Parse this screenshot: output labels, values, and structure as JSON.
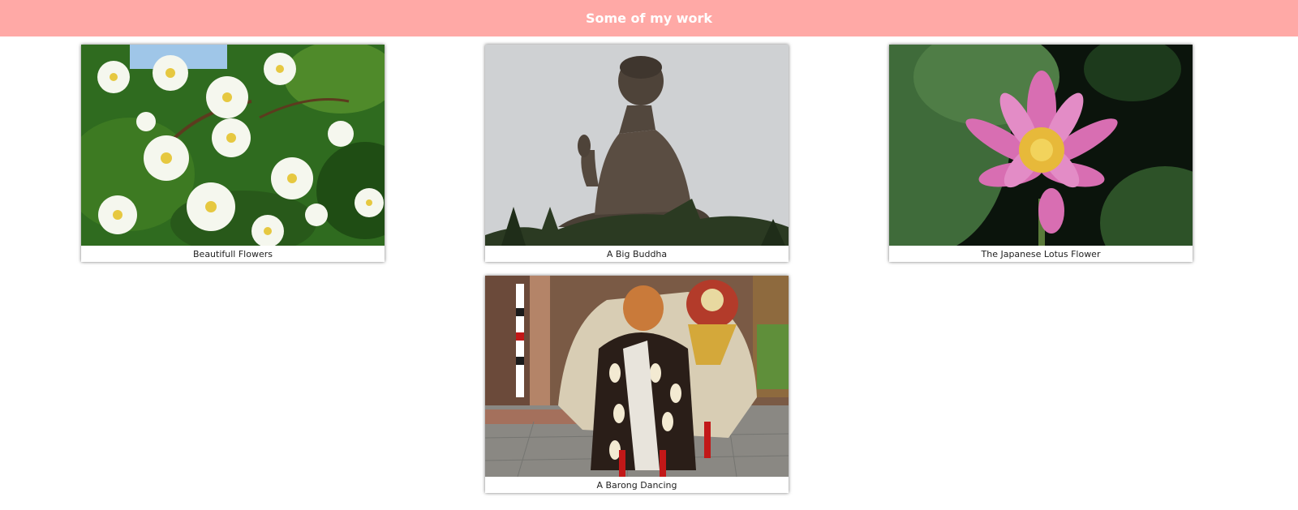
{
  "header": {
    "title": "Some of my work",
    "background": "#ffa9a6"
  },
  "gallery": [
    {
      "caption": "Beautifull Flowers",
      "image": "white-jasmine-flowers-photo"
    },
    {
      "caption": "A Big Buddha",
      "image": "big-buddha-statue-photo"
    },
    {
      "caption": "The Japanese Lotus Flower",
      "image": "pink-lotus-flower-photo"
    },
    {
      "caption": "A Barong Dancing",
      "image": "barong-dancer-photo"
    }
  ]
}
